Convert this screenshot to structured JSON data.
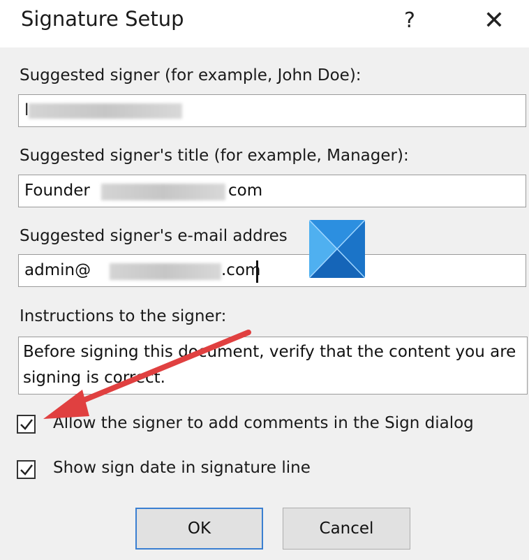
{
  "dialog": {
    "title": "Signature Setup",
    "help_label": "?",
    "close_label": "✕"
  },
  "fields": {
    "signer_label": "Suggested signer (for example, John Doe):",
    "signer_value": "l",
    "title_label": "Suggested signer's title (for example, Manager):",
    "title_prefix": "Founder",
    "title_suffix": "com",
    "email_label": "Suggested signer's e-mail addres",
    "email_prefix": "admin@",
    "email_suffix": ".com",
    "instructions_label": "Instructions to the signer:",
    "instructions_value": "Before signing this document, verify that the content you are signing is correct."
  },
  "options": {
    "allow_comments_label": "Allow the signer to add comments in the Sign dialog",
    "allow_comments_checked": true,
    "show_date_label": "Show sign date in signature line",
    "show_date_checked": true
  },
  "buttons": {
    "ok_label": "OK",
    "cancel_label": "Cancel"
  },
  "colors": {
    "arrow": "#e04040",
    "logo_blue": "#1e7fd6",
    "logo_light": "#4fb0f0",
    "ok_border": "#3a7fd1"
  }
}
